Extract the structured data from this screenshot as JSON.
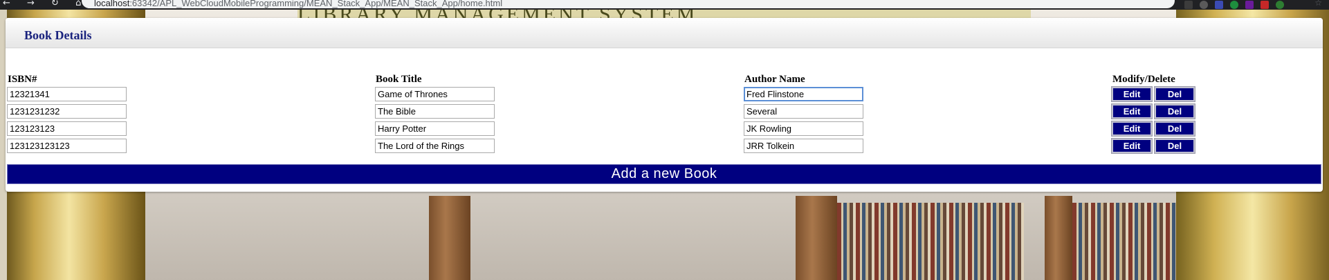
{
  "browser": {
    "url_host": "localhost",
    "url_path": ":63342/APL_WebCloudMobileProgramming/MEAN_Stack_App/MEAN_Stack_App/home.html",
    "nav_glyphs": "← → ↻ ⌂",
    "star_glyph": "☆",
    "background_title": "LIBRARY MANAGEMENT SYSTEM"
  },
  "panel": {
    "title": "Book Details"
  },
  "table": {
    "headers": [
      "ISBN#",
      "Book Title",
      "Author Name",
      "Modify/Delete"
    ],
    "rows": [
      {
        "isbn": "12321341",
        "title": "Game of Thrones",
        "author": "Fred Flinstone"
      },
      {
        "isbn": "1231231232",
        "title": "The Bible",
        "author": "Several"
      },
      {
        "isbn": "123123123",
        "title": "Harry Potter",
        "author": "JK Rowling"
      },
      {
        "isbn": "123123123123",
        "title": "The Lord of the Rings",
        "author": "JRR Tolkein"
      }
    ],
    "edit_label": "Edit",
    "delete_label": "Del"
  },
  "add_button_label": "Add a new Book",
  "colors": {
    "button_bg": "#000080",
    "heading_text": "#1a237e",
    "focus_border": "#5b8fd6"
  }
}
